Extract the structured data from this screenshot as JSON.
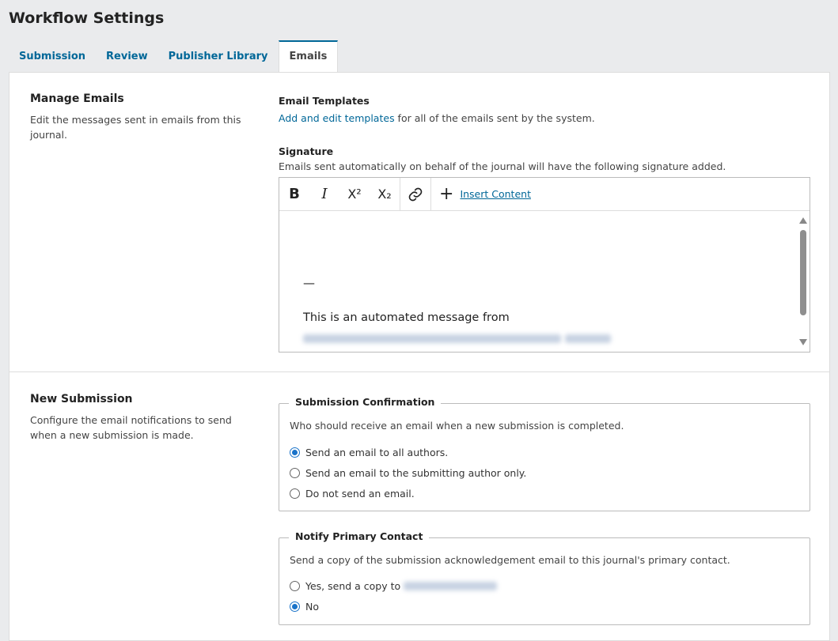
{
  "page": {
    "title": "Workflow Settings"
  },
  "tabs": [
    {
      "label": "Submission"
    },
    {
      "label": "Review"
    },
    {
      "label": "Publisher Library"
    },
    {
      "label": "Emails"
    }
  ],
  "manage_emails": {
    "heading": "Manage Emails",
    "description": "Edit the messages sent in emails from this journal.",
    "templates_label": "Email Templates",
    "templates_link": "Add and edit templates",
    "templates_text": " for all of the emails sent by the system.",
    "signature_label": "Signature",
    "signature_desc": "Emails sent automatically on behalf of the journal will have the following signature added.",
    "toolbar": {
      "bold": "B",
      "italic": "I",
      "superscript": "X²",
      "subscript": "X₂",
      "insert_label": "Insert Content"
    },
    "editor_dash": "—",
    "editor_text": "This is an automated message from"
  },
  "new_submission": {
    "heading": "New Submission",
    "description": "Configure the email notifications to send when a new submission is made.",
    "confirmation": {
      "legend": "Submission Confirmation",
      "description": "Who should receive an email when a new submission is completed.",
      "options": [
        {
          "label": "Send an email to all authors.",
          "checked": true
        },
        {
          "label": "Send an email to the submitting author only.",
          "checked": false
        },
        {
          "label": "Do not send an email.",
          "checked": false
        }
      ]
    },
    "primary_contact": {
      "legend": "Notify Primary Contact",
      "description": "Send a copy of the submission acknowledgement email to this journal's primary contact.",
      "options": [
        {
          "label": "Yes, send a copy to",
          "checked": false
        },
        {
          "label": "No",
          "checked": true
        }
      ]
    }
  },
  "colors": {
    "accent": "#006798",
    "radio_checked": "#1a73c9"
  }
}
